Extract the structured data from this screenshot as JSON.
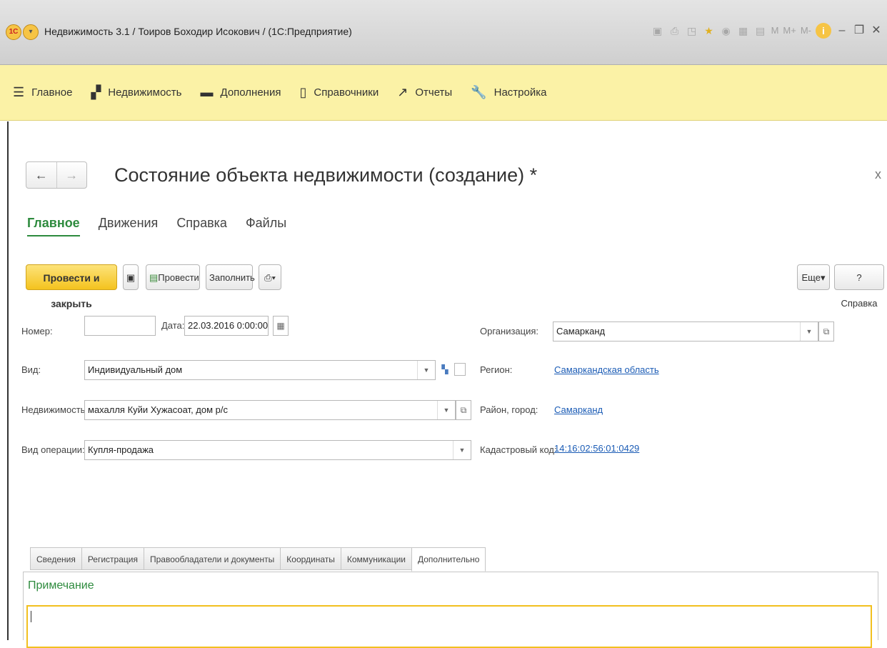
{
  "window": {
    "title": "Недвижимость 3.1 / Тоиров Боходир Исокович /  (1С:Предприятие)"
  },
  "toolbar_icons": [
    "save-icon",
    "print-icon",
    "preview-icon",
    "favorite-star-icon",
    "history-icon",
    "calculator-icon",
    "calendar-icon"
  ],
  "memory_buttons": [
    "M",
    "M+",
    "M-"
  ],
  "sections": [
    {
      "label": "Главное",
      "icon": "hamburger-menu-icon"
    },
    {
      "label": "Недвижимость",
      "icon": "building-icon"
    },
    {
      "label": "Дополнения",
      "icon": "folder-icon"
    },
    {
      "label": "Справочники",
      "icon": "books-icon"
    },
    {
      "label": "Отчеты",
      "icon": "chart-line-icon"
    },
    {
      "label": "Настройка",
      "icon": "wrench-icon"
    }
  ],
  "form": {
    "title": "Состояние объекта недвижимости (создание) *",
    "close_label": "x",
    "tabs": [
      "Главное",
      "Движения",
      "Справка",
      "Файлы"
    ],
    "buttons": {
      "post_close": "Провести и закрыть",
      "post": "Провести",
      "fill": "Заполнить",
      "more": "Еще",
      "help": "Справка"
    },
    "fields": {
      "number_label": "Номер:",
      "number_value": "",
      "date_label": "Дата:",
      "date_value": "22.03.2016  0:00:00",
      "kind_label": "Вид:",
      "kind_value": "Индивидуальный дом",
      "property_label": "Недвижимость:",
      "property_value": "махалля Куйи Хужасоат, дом р/с",
      "operation_label": "Вид операции:",
      "operation_value": "Купля-продажа",
      "org_label": "Организация:",
      "org_value": "Самарканд",
      "region_label": "Регион:",
      "region_value": "Самаркандская область",
      "district_label": "Район, город:",
      "district_value": "Самарканд",
      "cadastral_label": "Кадастровый код:",
      "cadastral_value": "14:16:02:56:01:0429"
    },
    "subtabs": [
      "Сведения",
      "Регистрация",
      "Правообладатели и документы",
      "Координаты",
      "Коммуникации",
      "Дополнительно"
    ],
    "active_subtab": "Дополнительно",
    "note_label": "Примечание",
    "note_value": ""
  },
  "colors": {
    "accent_yellow": "#f4c31e",
    "sections_bg": "#fbf2a6",
    "active_green": "#2e8b3e",
    "link_blue": "#1a5bb5"
  }
}
